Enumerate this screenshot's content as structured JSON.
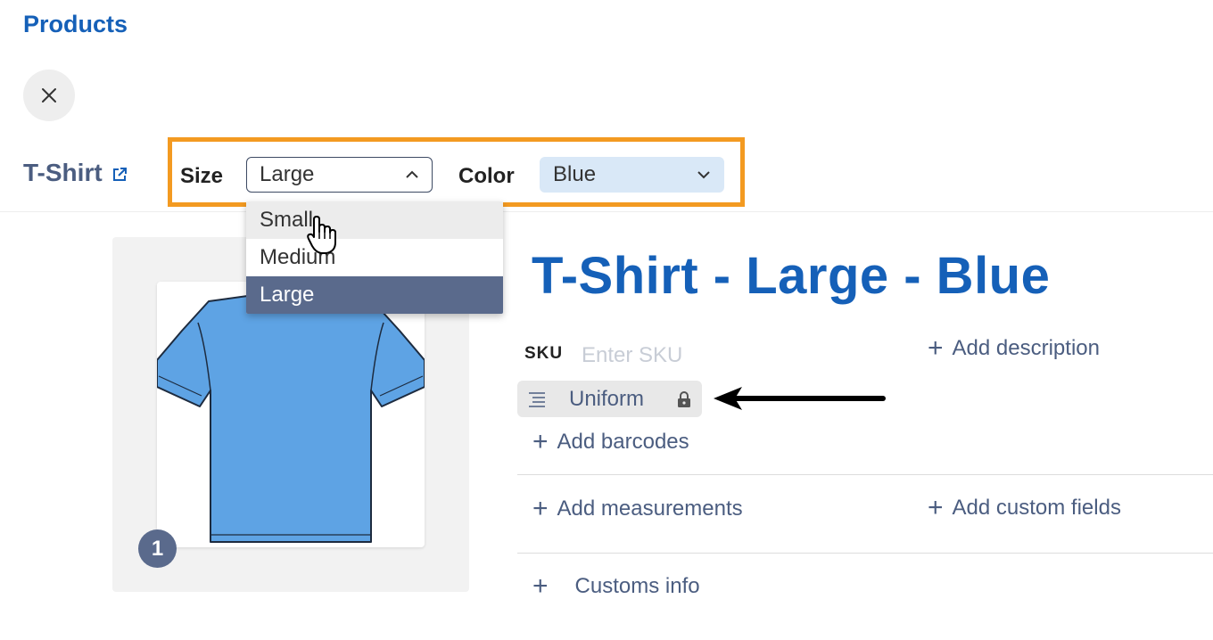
{
  "breadcrumb": {
    "label": "Products"
  },
  "product": {
    "name": "T-Shirt"
  },
  "variant_options": {
    "size_label": "Size",
    "size_value": "Large",
    "color_label": "Color",
    "color_value": "Blue"
  },
  "size_dropdown": {
    "options": [
      "Small",
      "Medium",
      "Large"
    ],
    "hovered": "Small",
    "selected": "Large"
  },
  "image": {
    "badge_count": "1",
    "shirt_color": "#5ea3e4"
  },
  "variant": {
    "title": "T-Shirt - Large - Blue",
    "sku_label": "SKU",
    "sku_placeholder": "Enter SKU",
    "sku_value": "",
    "uniform_label": "Uniform"
  },
  "actions": {
    "add_description": "Add description",
    "add_barcodes": "Add barcodes",
    "add_measurements": "Add measurements",
    "add_custom_fields": "Add custom fields",
    "customs_info": "Customs info"
  },
  "colors": {
    "accent": "#1560b8",
    "highlight_border": "#f39a21",
    "selected_option": "#5a6a8c",
    "color_select_bg": "#d9e8f7"
  }
}
